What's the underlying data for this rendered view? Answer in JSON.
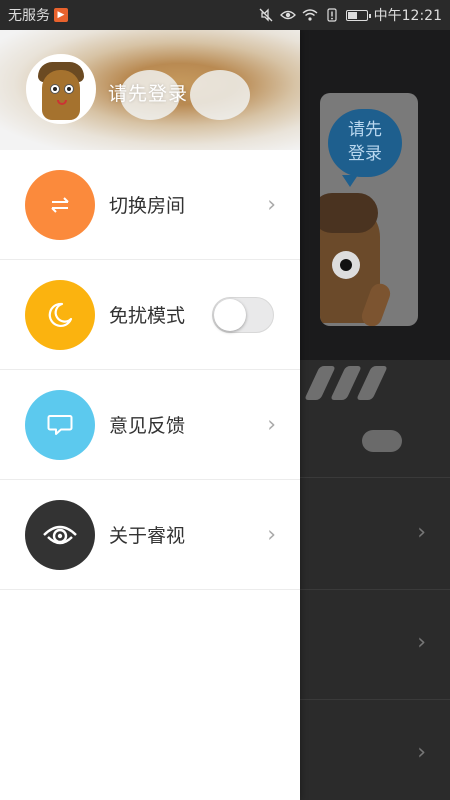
{
  "status_bar": {
    "carrier": "无服务",
    "time": "中午12:21",
    "icons": [
      "app-notification-icon",
      "mute-icon",
      "eye-icon",
      "wifi-icon",
      "alert-icon",
      "battery-icon"
    ],
    "battery_level": 0.5
  },
  "drawer": {
    "header": {
      "login_text": "请先登录"
    },
    "menu": [
      {
        "label": "切换房间",
        "icon": "swap-arrows-icon",
        "color": "#fb8a3c",
        "control": "chevron"
      },
      {
        "label": "免扰模式",
        "icon": "moon-icon",
        "color": "#fbb30f",
        "control": "toggle",
        "toggle_on": false
      },
      {
        "label": "意见反馈",
        "icon": "chat-bubble-icon",
        "color": "#5cc9ee",
        "control": "chevron"
      },
      {
        "label": "关于睿视",
        "icon": "eye-logo-icon",
        "color": "#333333",
        "control": "chevron"
      }
    ]
  },
  "background": {
    "bubble_text_line1": "请先",
    "bubble_text_line2": "登录"
  }
}
